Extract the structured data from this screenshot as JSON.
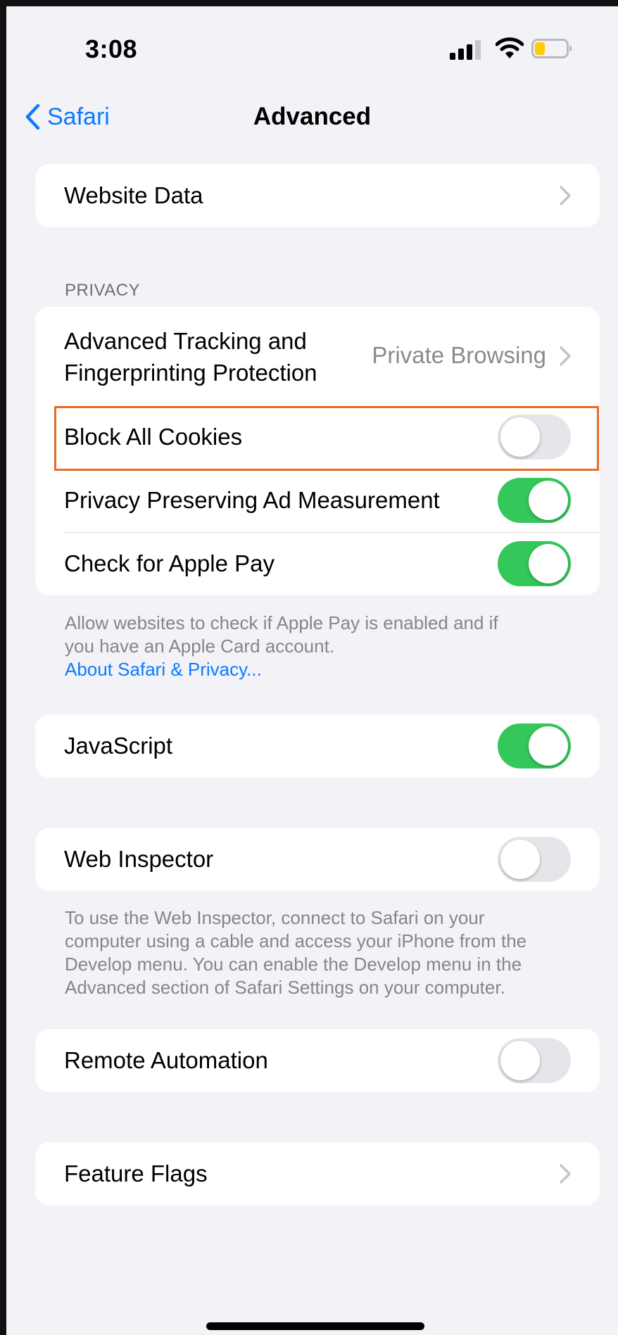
{
  "status_bar": {
    "time": "3:08",
    "signal_icon": "cellular-signal-icon",
    "wifi_icon": "wifi-icon",
    "battery_icon": "battery-low-icon",
    "battery_color": "#ffcc00"
  },
  "nav": {
    "back_label": "Safari",
    "title": "Advanced"
  },
  "website_data": {
    "label": "Website Data"
  },
  "privacy": {
    "header": "PRIVACY",
    "tracking": {
      "label_line1": "Advanced Tracking and",
      "label_line2": "Fingerprinting Protection",
      "value": "Private Browsing"
    },
    "block_cookies": {
      "label": "Block All Cookies",
      "on": false
    },
    "ad_measurement": {
      "label": "Privacy Preserving Ad Measurement",
      "on": true
    },
    "apple_pay": {
      "label": "Check for Apple Pay",
      "on": true
    },
    "footer_line1": "Allow websites to check if Apple Pay is enabled and if",
    "footer_line2": "you have an Apple Card account.",
    "footer_link": "About Safari & Privacy..."
  },
  "javascript": {
    "label": "JavaScript",
    "on": true
  },
  "web_inspector": {
    "label": "Web Inspector",
    "on": false,
    "footer_line1": "To use the Web Inspector, connect to Safari on your",
    "footer_line2": "computer using a cable and access your iPhone from the",
    "footer_line3": "Develop menu. You can enable the Develop menu in the",
    "footer_line4": "Advanced section of Safari Settings on your computer."
  },
  "remote_automation": {
    "label": "Remote Automation",
    "on": false
  },
  "feature_flags": {
    "label": "Feature Flags"
  },
  "colors": {
    "accent": "#0a7bff",
    "toggle_on": "#34c759",
    "highlight": "#ee6a1f"
  }
}
